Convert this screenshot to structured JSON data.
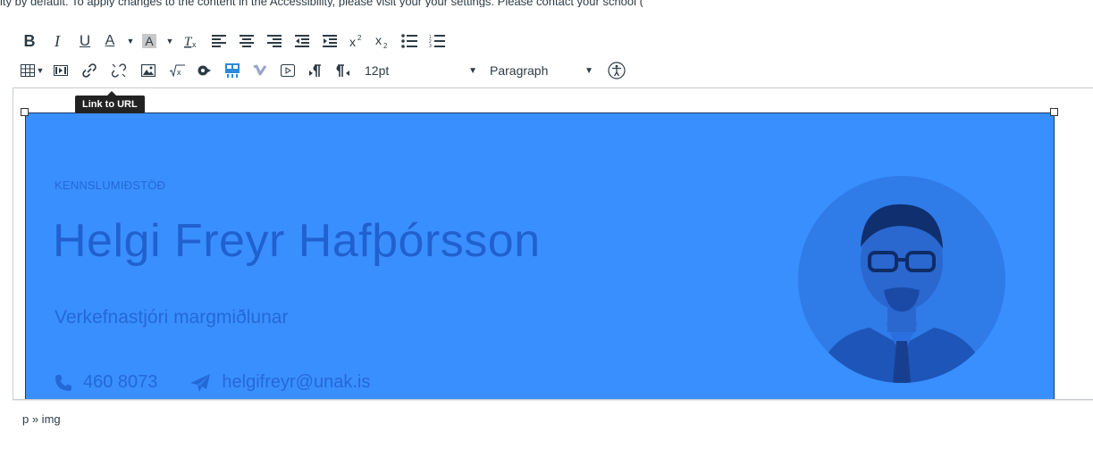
{
  "top_text": "ity by default. To apply changes to the content in the Accessibility, please visit your your settings. Please contact your school (",
  "toolbar": {
    "row1": [
      {
        "name": "bold-button",
        "label": "B"
      },
      {
        "name": "italic-button",
        "label": "I"
      },
      {
        "name": "underline-button",
        "label": "U"
      },
      {
        "name": "text-color-button",
        "label": "A"
      },
      {
        "name": "background-color-button",
        "label": "A"
      },
      {
        "name": "clear-formatting-button",
        "label": "Tx"
      }
    ],
    "font_size": "12pt",
    "block_format": "Paragraph"
  },
  "tooltip": "Link to URL",
  "content": {
    "kicker": "KENNSLUMIÐSTÖÐ",
    "name": "Helgi Freyr Hafþórsson",
    "role": "Verkefnastjóri margmiðlunar",
    "phone": "460 8073",
    "email": "helgifreyr@unak.is"
  },
  "status_path": "p » img",
  "colors": {
    "image_bg": "#3a8ffe",
    "text_blue": "#2160cf"
  }
}
